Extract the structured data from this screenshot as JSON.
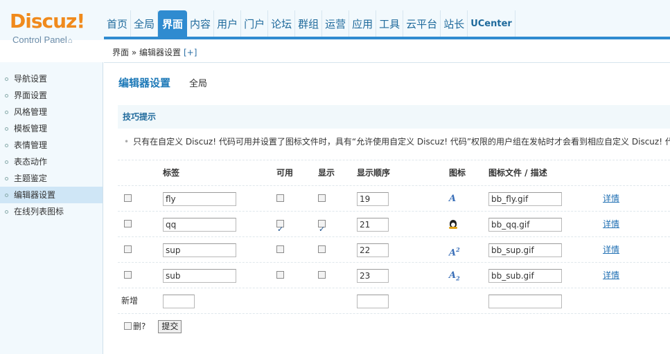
{
  "logo": {
    "main": "Discuz!",
    "sub": "Control Panel"
  },
  "topnav": [
    {
      "label": "首页",
      "active": false
    },
    {
      "label": "全局",
      "active": false
    },
    {
      "label": "界面",
      "active": true
    },
    {
      "label": "内容",
      "active": false
    },
    {
      "label": "用户",
      "active": false
    },
    {
      "label": "门户",
      "active": false
    },
    {
      "label": "论坛",
      "active": false
    },
    {
      "label": "群组",
      "active": false
    },
    {
      "label": "运营",
      "active": false
    },
    {
      "label": "应用",
      "active": false
    },
    {
      "label": "工具",
      "active": false
    },
    {
      "label": "云平台",
      "active": false
    },
    {
      "label": "站长",
      "active": false
    },
    {
      "label": "UCenter",
      "active": false
    }
  ],
  "breadcrumb": {
    "path": "界面 » 编辑器设置",
    "add": "[+]"
  },
  "sidebar": {
    "items": [
      {
        "label": "导航设置"
      },
      {
        "label": "界面设置"
      },
      {
        "label": "风格管理"
      },
      {
        "label": "模板管理"
      },
      {
        "label": "表情管理"
      },
      {
        "label": "表态动作"
      },
      {
        "label": "主题鉴定"
      },
      {
        "label": "编辑器设置",
        "active": true
      },
      {
        "label": "在线列表图标"
      }
    ]
  },
  "tabs": {
    "active": "编辑器设置",
    "other": "全局"
  },
  "tips": {
    "title": "技巧提示",
    "text": "只有在自定义 Discuz! 代码可用并设置了图标文件时，具有“允许使用自定义 Discuz! 代码”权限的用户组在发帖时才会看到相应自定义 Discuz! 代码"
  },
  "table": {
    "headers": {
      "label": "标签",
      "available": "可用",
      "show": "显示",
      "order": "显示顺序",
      "icon": "图标",
      "file": "图标文件 / 描述"
    },
    "rows": [
      {
        "label": "fly",
        "available": false,
        "show": false,
        "order": "19",
        "icon": "A",
        "file": "bb_fly.gif",
        "link": "详情"
      },
      {
        "label": "qq",
        "available": true,
        "show": true,
        "order": "21",
        "icon": "qq",
        "file": "bb_qq.gif",
        "link": "详情"
      },
      {
        "label": "sup",
        "available": false,
        "show": false,
        "order": "22",
        "icon": "A",
        "file": "bb_sup.gif",
        "link": "详情"
      },
      {
        "label": "sub",
        "available": false,
        "show": false,
        "order": "23",
        "icon": "A",
        "file": "bb_sub.gif",
        "link": "详情"
      }
    ],
    "new_label": "新增",
    "delete_label": "删?",
    "submit_label": "提交"
  },
  "colors": {
    "accent": "#2f8bd0",
    "logo": "#f08a1c",
    "sidebar_bg": "#f2f9fd",
    "link": "#1f6fb3"
  }
}
